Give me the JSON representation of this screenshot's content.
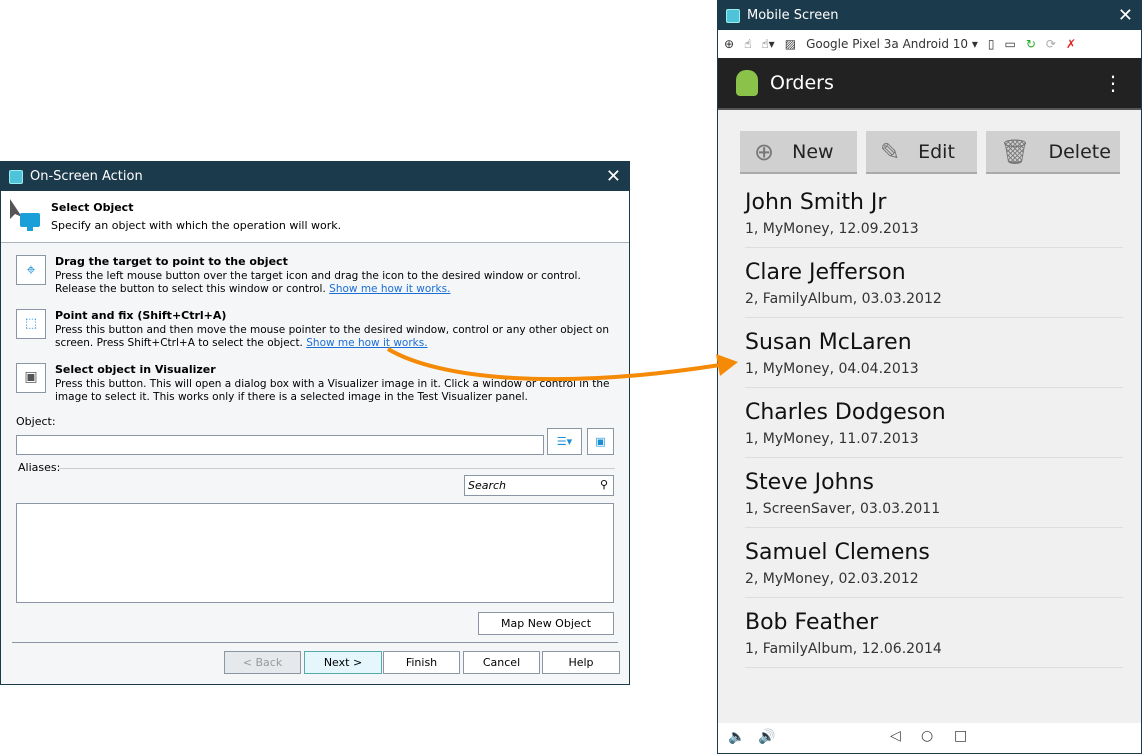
{
  "dialog": {
    "title": "On-Screen Action",
    "header_title": "Select Object",
    "header_subtitle": "Specify an object with which the operation will work.",
    "options": [
      {
        "title": "Drag the target to point to the object",
        "text": "Press the left mouse button over the target icon and drag the icon to the desired window or control. Release the button to select this window or control.",
        "link": "Show me how it works."
      },
      {
        "title": "Point and fix (Shift+Ctrl+A)",
        "text": "Press this button and then move the mouse pointer to the desired window, control or any other object on screen. Press Shift+Ctrl+A to select the object.",
        "link": "Show me how it works."
      },
      {
        "title": "Select object in Visualizer",
        "text": "Press this button. This will open a dialog box with a Visualizer image in it. Click a window or control in the image to select it. This works only if there is a selected image in the Test Visualizer panel.",
        "link": ""
      }
    ],
    "object_label": "Object:",
    "object_value": "",
    "aliases_label": "Aliases:",
    "search_placeholder": "Search",
    "map_button": "Map New Object",
    "buttons": {
      "back": "< Back",
      "next": "Next >",
      "finish": "Finish",
      "cancel": "Cancel",
      "help": "Help"
    }
  },
  "mobile": {
    "title": "Mobile Screen",
    "device": "Google Pixel 3a Android 10",
    "app_title": "Orders",
    "buttons": {
      "new": "New",
      "edit": "Edit",
      "delete": "Delete"
    },
    "orders": [
      {
        "name": "John Smith Jr",
        "detail": "1, MyMoney, 12.09.2013"
      },
      {
        "name": "Clare Jefferson",
        "detail": "2, FamilyAlbum, 03.03.2012"
      },
      {
        "name": "Susan McLaren",
        "detail": "1, MyMoney, 04.04.2013"
      },
      {
        "name": "Charles Dodgeson",
        "detail": "1, MyMoney, 11.07.2013"
      },
      {
        "name": "Steve Johns",
        "detail": "1, ScreenSaver, 03.03.2011"
      },
      {
        "name": "Samuel Clemens",
        "detail": "2, MyMoney, 02.03.2012"
      },
      {
        "name": "Bob Feather",
        "detail": "1, FamilyAlbum, 12.06.2014"
      }
    ]
  },
  "colors": {
    "titlebar": "#1b3a4b",
    "arrow": "#f58a07",
    "link": "#1a6fd6"
  }
}
